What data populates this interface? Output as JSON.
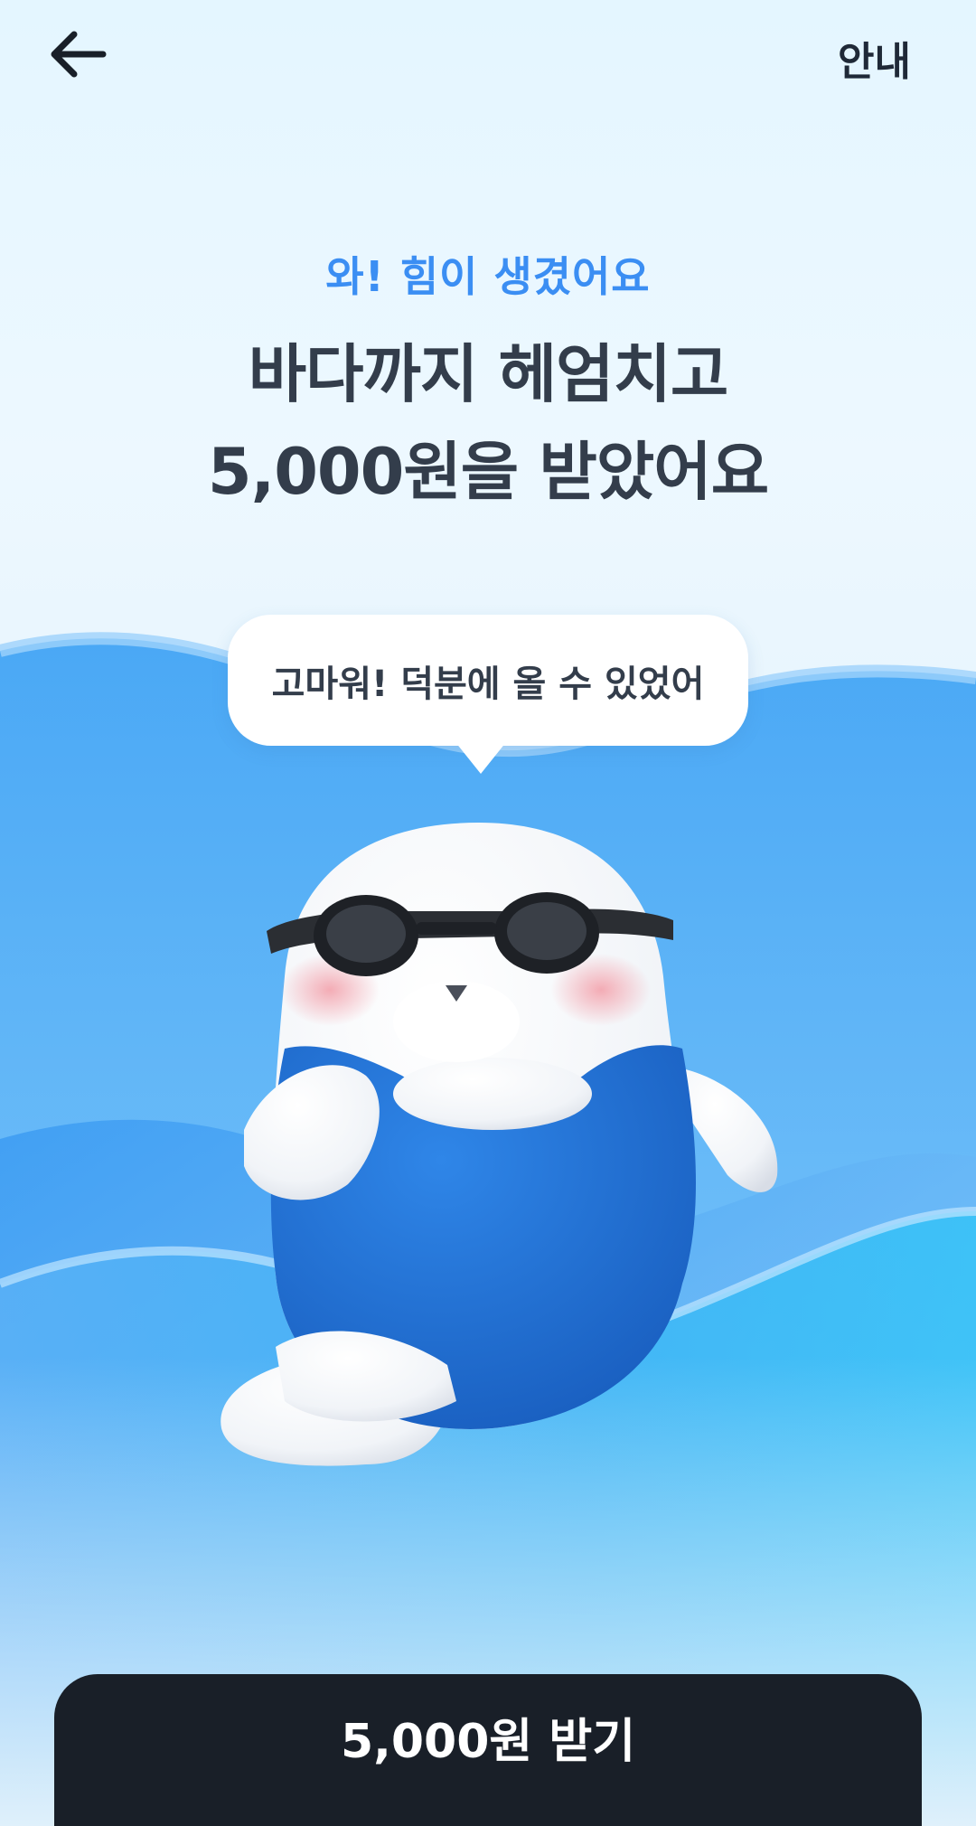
{
  "topbar": {
    "back_icon": "arrow-left-icon",
    "info_label": "안내"
  },
  "header": {
    "subtitle": "와! 힘이 생겼어요",
    "title_line1": "바다까지 헤엄치고",
    "title_line2": "5,000원을 받았어요"
  },
  "speech_bubble": {
    "text": "고마워! 덕분에 올 수 있었어"
  },
  "cta": {
    "label": "5,000원 받기"
  },
  "colors": {
    "accent": "#3b8ef3",
    "title_text": "#333d4b",
    "button_bg": "#191f28",
    "wave_blue": "#3a9af0",
    "swimsuit_blue": "#1f6fd0"
  }
}
